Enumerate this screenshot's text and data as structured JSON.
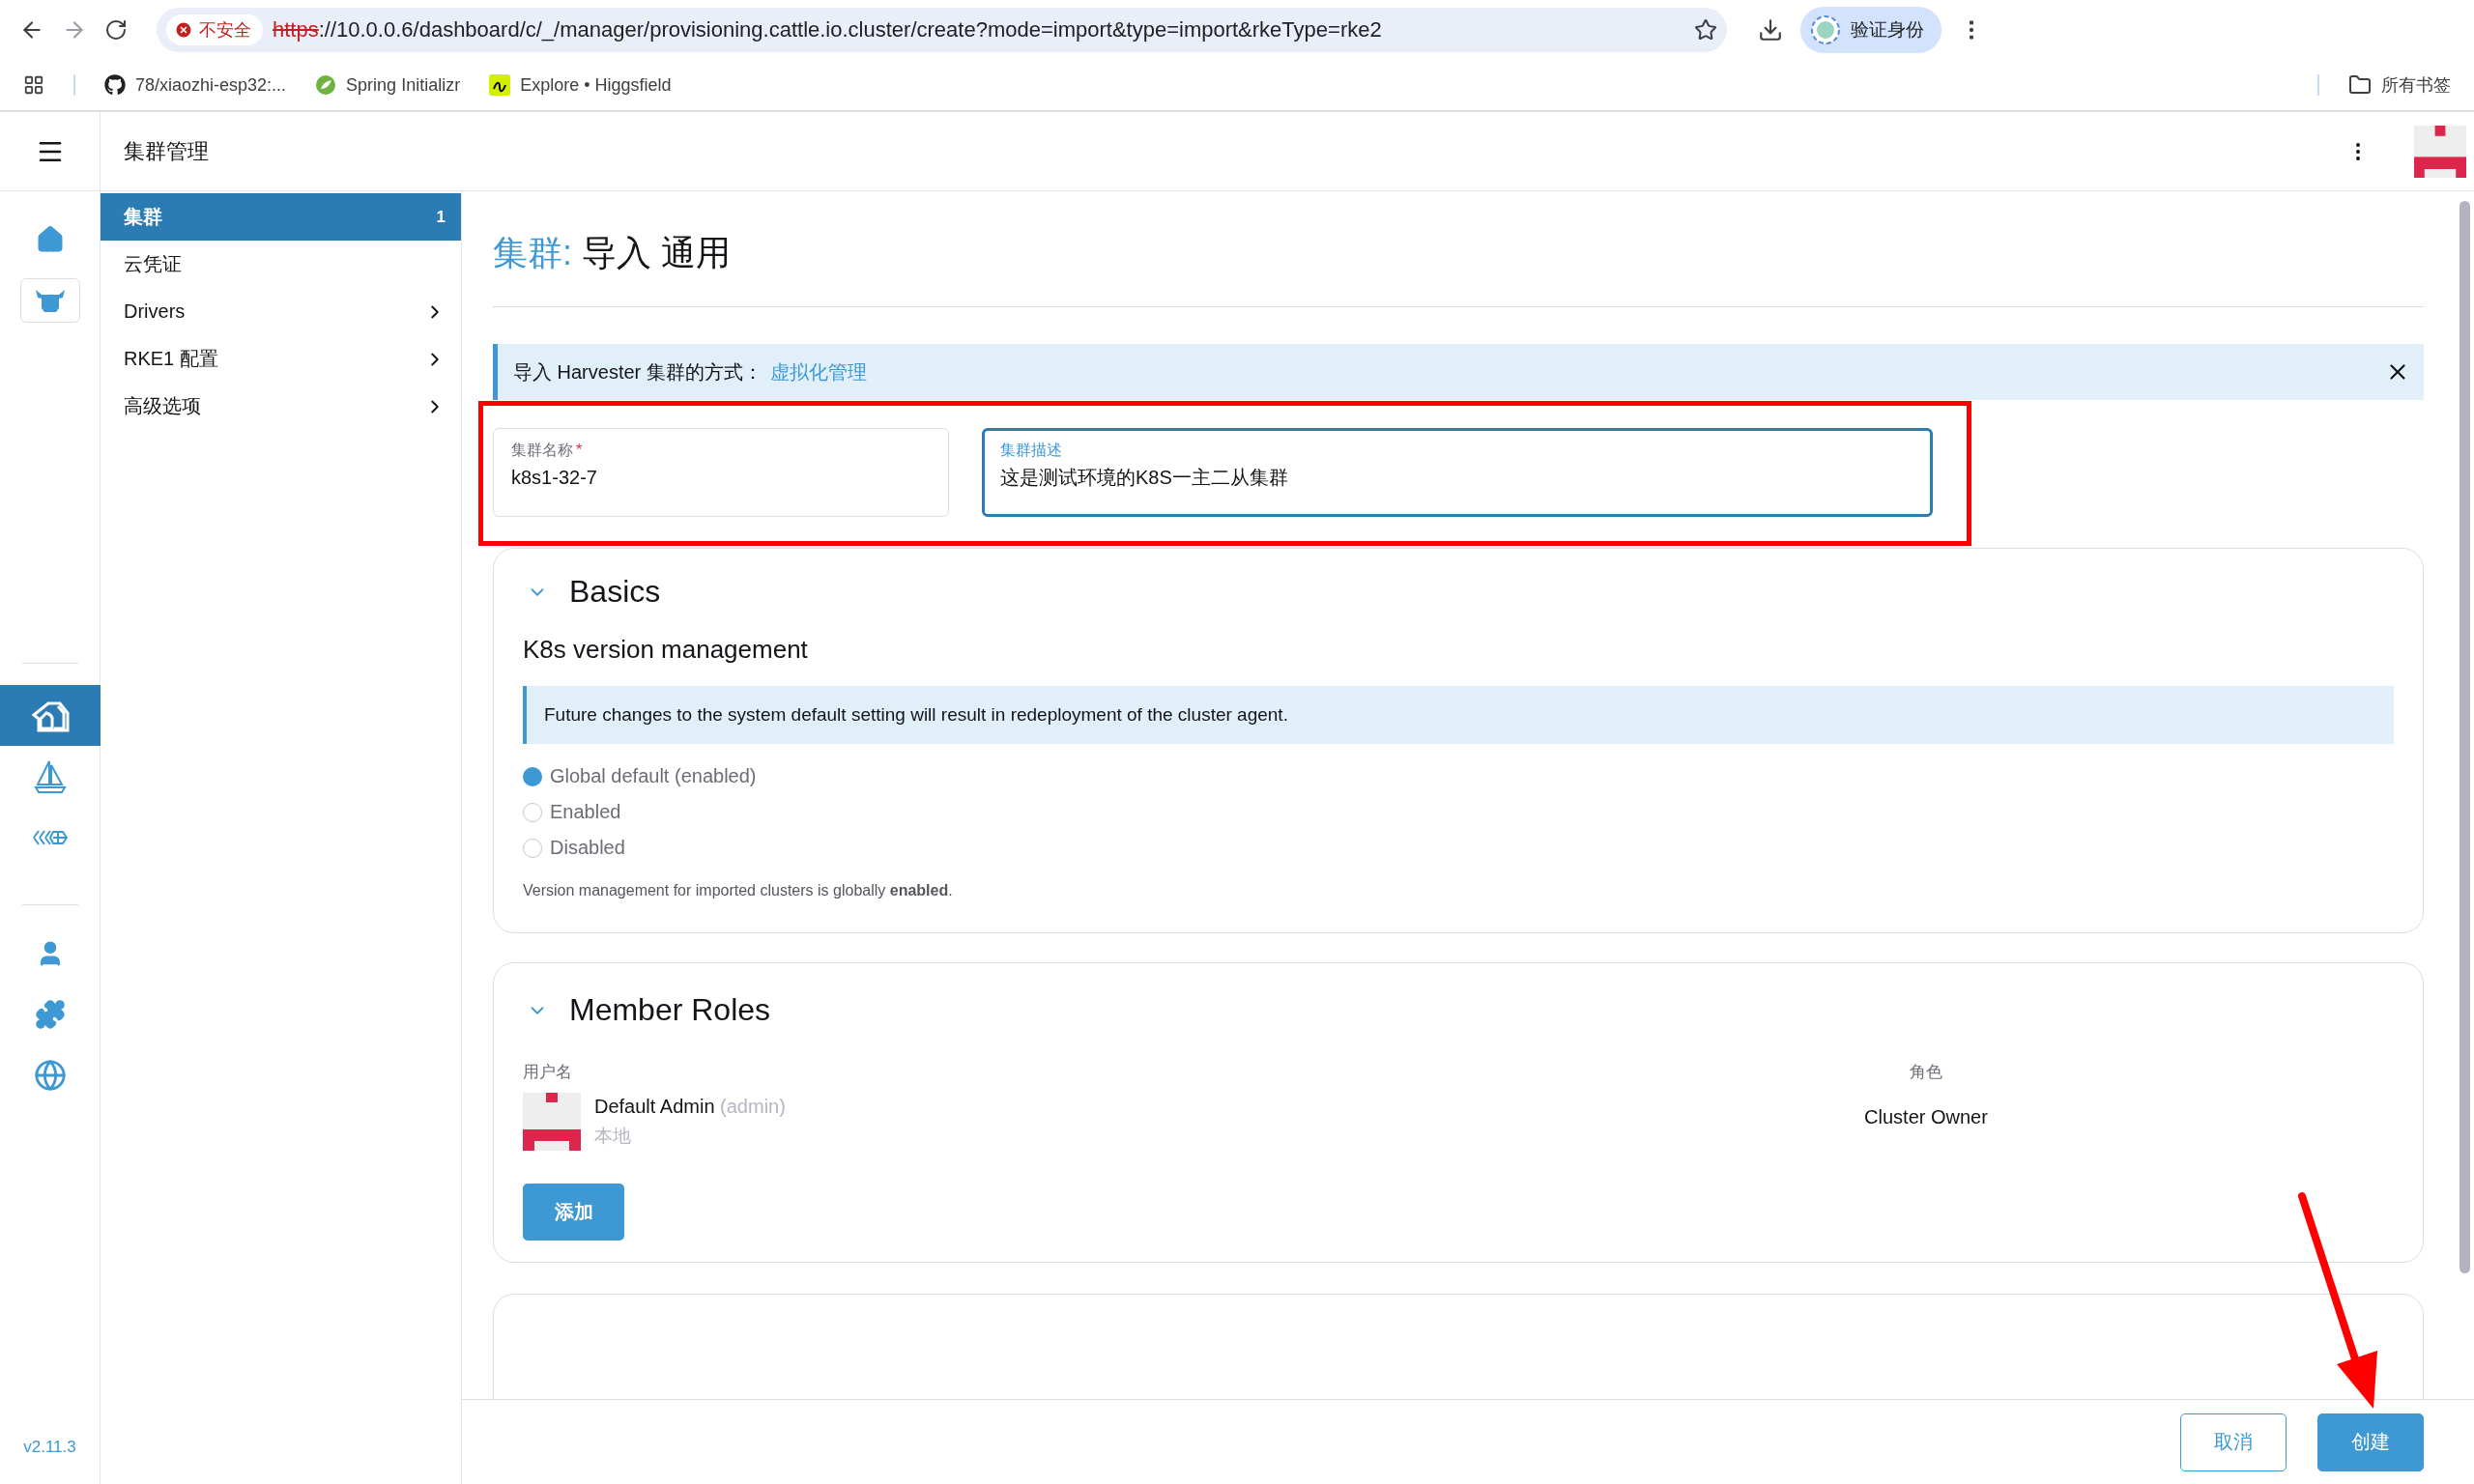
{
  "browser": {
    "security_label": "不安全",
    "scheme": "https",
    "url_rest": "://10.0.0.6/dashboard/c/_/manager/provisioning.cattle.io.cluster/create?mode=import&type=import&rkeType=rke2",
    "profile_label": "验证身份"
  },
  "bookmarks": [
    {
      "kind": "github",
      "label": "78/xiaozhi-esp32:..."
    },
    {
      "kind": "spring",
      "label": "Spring Initializr"
    },
    {
      "kind": "higgsfield",
      "label": "Explore • Higgsfield"
    }
  ],
  "all_bookmarks": "所有书签",
  "header": {
    "title": "集群管理"
  },
  "rail": {
    "top": [
      {
        "kind": "home",
        "selected": false
      },
      {
        "kind": "cow",
        "selected": false
      }
    ],
    "middle": [
      {
        "kind": "barn",
        "selected": true
      },
      {
        "kind": "sail",
        "selected": false
      },
      {
        "kind": "harvester",
        "selected": false
      }
    ],
    "bottom": [
      {
        "kind": "user",
        "selected": false
      },
      {
        "kind": "puzzle",
        "selected": false
      },
      {
        "kind": "globe",
        "selected": false
      }
    ],
    "version": "v2.11.3"
  },
  "nav": [
    {
      "label": "集群",
      "badge": "1",
      "selected": true,
      "expandable": false
    },
    {
      "label": "云凭证",
      "selected": false,
      "expandable": false
    },
    {
      "label": "Drivers",
      "selected": false,
      "expandable": true
    },
    {
      "label": "RKE1 配置",
      "selected": false,
      "expandable": true
    },
    {
      "label": "高级选项",
      "selected": false,
      "expandable": true
    }
  ],
  "page": {
    "title_prefix": "集群:",
    "title": "导入 通用"
  },
  "banner": {
    "text": "导入 Harvester 集群的方式：",
    "link": "虚拟化管理"
  },
  "fields": [
    {
      "label": "集群名称",
      "required_mark": "*",
      "value": "k8s1-32-7",
      "focused": false
    },
    {
      "label": "集群描述",
      "value": "这是测试环境的K8S一主二从集群",
      "focused": true
    }
  ],
  "basics": {
    "title": "Basics",
    "expanded": true,
    "subtitle": "K8s version management",
    "info": "Future changes to the system default setting will result in redeployment of the cluster agent.",
    "options": [
      {
        "label": "Global default (enabled)",
        "selected": true
      },
      {
        "label": "Enabled",
        "selected": false
      },
      {
        "label": "Disabled",
        "selected": false
      }
    ],
    "note": "Version management for imported clusters is globally **enabled**."
  },
  "member_roles": {
    "title": "Member Roles",
    "expanded": true,
    "columns": [
      "用户名",
      "角色"
    ],
    "members": [
      {
        "name": "Default Admin",
        "username": "(admin)",
        "provider": "本地",
        "role": "Cluster Owner"
      }
    ],
    "add_button": "添加"
  },
  "footer": {
    "cancel": "取消",
    "create": "创建"
  },
  "annotations": [
    {
      "kind": "box"
    },
    {
      "kind": "arrow"
    }
  ]
}
